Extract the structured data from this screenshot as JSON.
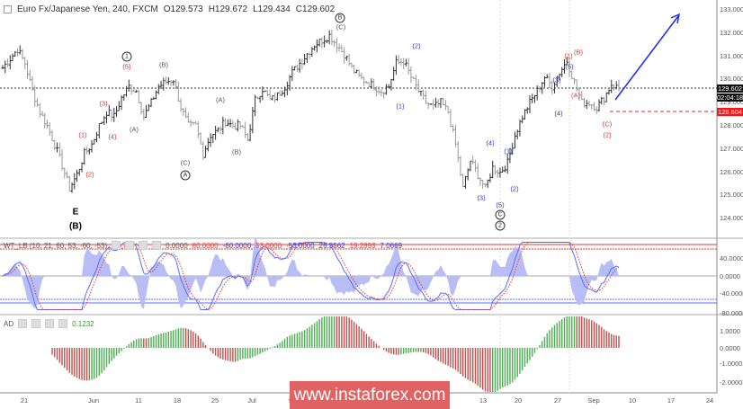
{
  "header": {
    "symbol": "Euro Fx/Japanese Yen, 240, FXCM",
    "open": "O129.573",
    "high": "H129.672",
    "low": "L129.434",
    "close": "C129.602"
  },
  "wt": {
    "label": "WT_LB (10, 21, 60, 53, -60, -53)",
    "values": [
      "0.0000",
      "60.0000",
      "-60.0000",
      "53.0000",
      "-53.0000",
      "26.3562",
      "19.2893",
      "7.0669"
    ],
    "axis": [
      "40.0000",
      "0.0000",
      "-40.0000",
      "-80.0000"
    ]
  },
  "ad": {
    "label": "AD",
    "value": "0.1232",
    "axis": [
      "1.0000",
      "0.0000",
      "-1.0000",
      "-2.0000"
    ]
  },
  "price_tags": {
    "last": "129.602",
    "countdown": "02:04:18",
    "target": "128.604"
  },
  "waves": [
    "E",
    "(B)",
    "1",
    "(5)",
    "(3)",
    "(1)",
    "(4)",
    "(2)",
    "(A)",
    "(B)",
    "(A)",
    "(C)",
    "A",
    "(B)",
    "B",
    "(C)",
    "(2)",
    "(1)",
    "(4)",
    "(3)",
    "(5)",
    "C",
    "2",
    "(1)",
    "(2)",
    "(3)",
    "(4)",
    "(5)",
    "(1)",
    "(B)",
    "(A)",
    "(C)",
    "(2)"
  ],
  "watermark": "www.instaforex.com",
  "colors": {
    "up": "#4caf50",
    "down": "#c0504d",
    "wt1": "#5b6cff",
    "wt2": "#e53935",
    "arrow": "#1a2fe0"
  },
  "chart_data": {
    "type": "ohlc",
    "title": "Euro Fx/Japanese Yen, 240, FXCM",
    "y_ticks": [
      "133.000",
      "132.000",
      "131.000",
      "130.000",
      "129.000",
      "128.000",
      "127.000",
      "126.000",
      "125.000",
      "124.000"
    ],
    "ylim": [
      123.6,
      133.4
    ],
    "x_ticks": [
      "21",
      "Jun",
      "11",
      "18",
      "25",
      "Jul",
      "9",
      "16",
      "23",
      "Aug",
      "13",
      "20",
      "27",
      "Sep",
      "10",
      "17",
      "24"
    ],
    "closes": [
      130.5,
      130.9,
      131.3,
      130.7,
      129.5,
      128.6,
      128.0,
      127.2,
      126.3,
      125.3,
      125.9,
      126.8,
      127.2,
      128.0,
      128.6,
      128.4,
      129.2,
      129.7,
      129.5,
      128.4,
      129.0,
      129.7,
      129.9,
      130.0,
      128.8,
      128.0,
      128.0,
      126.8,
      127.6,
      127.8,
      128.2,
      128.0,
      128.0,
      127.4,
      129.1,
      129.6,
      129.1,
      129.3,
      129.7,
      130.3,
      130.7,
      131.1,
      131.5,
      131.7,
      131.9,
      131.5,
      131.1,
      130.5,
      130.1,
      129.9,
      129.7,
      129.5,
      129.7,
      130.7,
      130.8,
      130.1,
      129.5,
      129.0,
      128.8,
      129.0,
      128.6,
      127.2,
      125.3,
      126.5,
      125.9,
      125.3,
      126.2,
      126.0,
      126.4,
      127.6,
      128.4,
      129.0,
      129.5,
      130.1,
      129.7,
      130.3,
      130.8,
      129.9,
      129.0,
      129.0,
      128.8,
      129.2,
      129.8,
      129.6
    ],
    "last_price": 129.602,
    "target_level": 128.604
  }
}
